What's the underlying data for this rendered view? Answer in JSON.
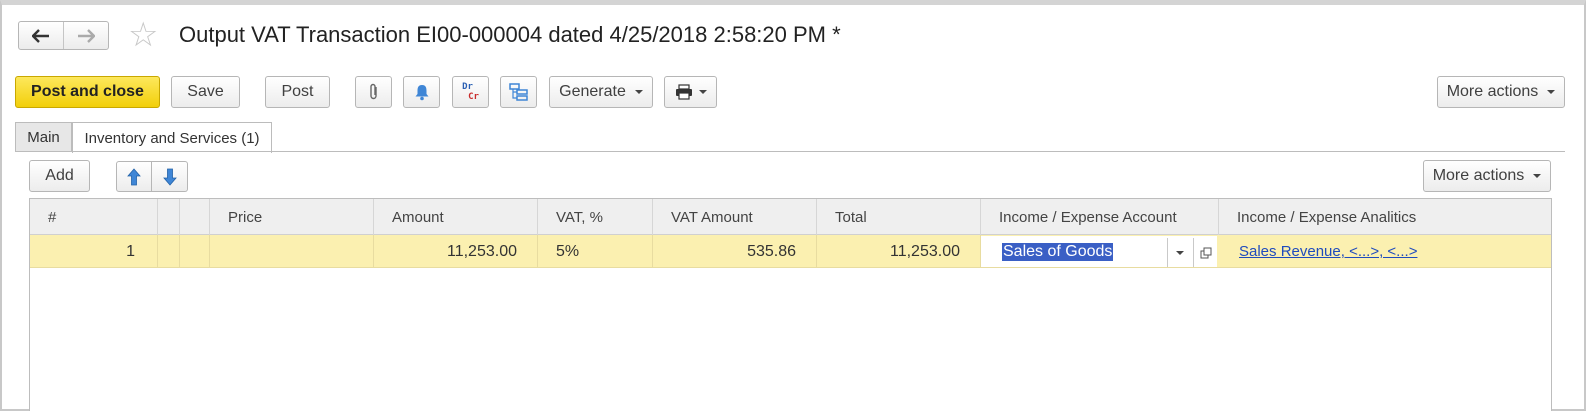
{
  "window": {
    "title": "Output VAT Transaction EI00-000004 dated 4/25/2018 2:58:20 PM *"
  },
  "nav": {
    "back_icon": "arrow-left-icon",
    "forward_icon": "arrow-right-icon",
    "favorite_icon": "star-icon"
  },
  "toolbar": {
    "post_and_close": "Post and close",
    "save": "Save",
    "post": "Post",
    "attach_icon": "paperclip-icon",
    "reminder_icon": "bell-icon",
    "drcr_top": "Dr",
    "drcr_bottom": "Cr",
    "structure_icon": "document-structure-icon",
    "generate": "Generate",
    "print_icon": "printer-icon",
    "more_actions": "More actions"
  },
  "tabs": [
    {
      "label": "Main",
      "active": false
    },
    {
      "label": "Inventory and Services (1)",
      "active": true
    }
  ],
  "table_toolbar": {
    "add": "Add",
    "move_up_icon": "arrow-up-icon",
    "move_down_icon": "arrow-down-icon",
    "more_actions": "More actions"
  },
  "table": {
    "columns": [
      "#",
      "",
      "",
      "Price",
      "Amount",
      "VAT, %",
      "VAT Amount",
      "Total",
      "Income / Expense Account",
      "Income / Expense Analitics"
    ],
    "rows": [
      {
        "num": "1",
        "price": "",
        "amount": "11,253.00",
        "vat_rate": "5%",
        "vat_amount": "535.86",
        "total": "11,253.00",
        "account": "Sales of Goods",
        "analytics": "Sales Revenue, <...>, <...>"
      }
    ]
  },
  "colors": {
    "accent_yellow": "#f5d31a",
    "row_highlight": "#fbf0b0",
    "selection": "#3a5fc5",
    "link": "#1f4bbd"
  }
}
